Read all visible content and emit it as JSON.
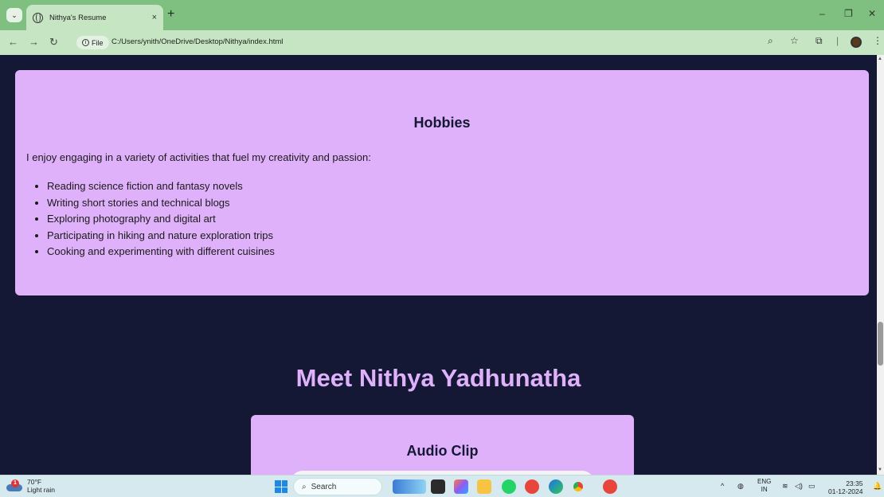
{
  "browser": {
    "tab_title": "Nithya's Resume",
    "tab_close": "×",
    "new_tab": "+",
    "file_chip": "File",
    "url": "C:/Users/ynith/OneDrive/Desktop/Nithya/index.html"
  },
  "hobbies": {
    "title": "Hobbies",
    "intro": "I enjoy engaging in a variety of activities that fuel my creativity and passion:",
    "items": [
      "Reading science fiction and fantasy novels",
      "Writing short stories and technical blogs",
      "Exploring photography and digital art",
      "Participating in hiking and nature exploration trips",
      "Cooking and experimenting with different cuisines"
    ]
  },
  "meet": {
    "heading": "Meet Nithya Yadhunatha"
  },
  "audio": {
    "title": "Audio Clip"
  },
  "taskbar": {
    "weather_badge": "1",
    "temperature": "70°F",
    "condition": "Light rain",
    "search_placeholder": "Search",
    "lang_top": "ENG",
    "lang_bottom": "IN",
    "time": "23:35",
    "date": "01-12-2024"
  },
  "colors": {
    "page_bg": "#141834",
    "card_bg": "#e0b1fb",
    "tabbar": "#7fbf7f",
    "toolbar": "#c6e5c3"
  }
}
